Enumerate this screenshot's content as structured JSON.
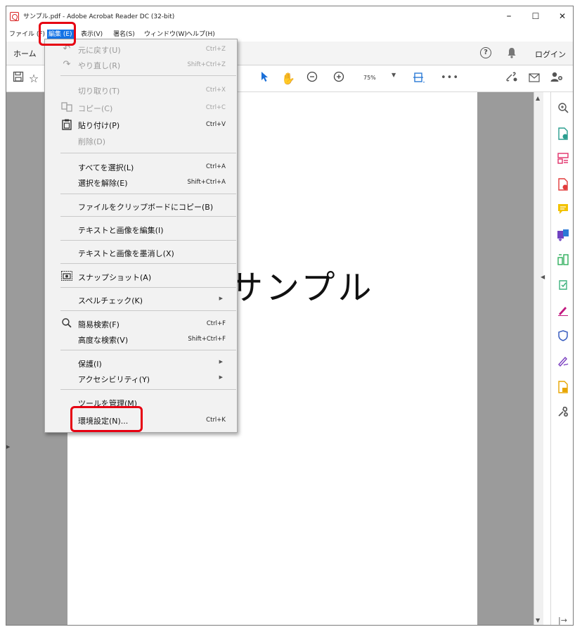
{
  "window": {
    "title": "サンプル.pdf - Adobe Acrobat Reader DC (32-bit)",
    "minimize": "–",
    "maximize": "☐",
    "close": "✕"
  },
  "menubar": {
    "items": [
      {
        "label": "ファイル (F)"
      },
      {
        "label": "編集 (E)"
      },
      {
        "label": "表示(V)"
      },
      {
        "label": "署名(S)"
      },
      {
        "label": "ウィンドウ(W)"
      },
      {
        "label": "ヘルプ(H)"
      }
    ]
  },
  "navbar": {
    "home": "ホーム",
    "help": "?",
    "login": "ログイン"
  },
  "toolbar": {
    "zoom": "75%"
  },
  "document": {
    "text": "サンプル"
  },
  "edit_menu": {
    "items": [
      {
        "label": "元に戻す(U)",
        "shortcut": "Ctrl+Z",
        "disabled": true
      },
      {
        "label": "やり直し(R)",
        "shortcut": "Shift+Ctrl+Z",
        "disabled": true
      },
      {
        "label": "切り取り(T)",
        "shortcut": "Ctrl+X",
        "disabled": true
      },
      {
        "label": "コピー(C)",
        "shortcut": "Ctrl+C",
        "disabled": true
      },
      {
        "label": "貼り付け(P)",
        "shortcut": "Ctrl+V",
        "disabled": false
      },
      {
        "label": "削除(D)",
        "shortcut": "",
        "disabled": true
      },
      {
        "label": "すべてを選択(L)",
        "shortcut": "Ctrl+A",
        "disabled": false
      },
      {
        "label": "選択を解除(E)",
        "shortcut": "Shift+Ctrl+A",
        "disabled": false
      },
      {
        "label": "ファイルをクリップボードにコピー(B)",
        "shortcut": "",
        "disabled": false
      },
      {
        "label": "テキストと画像を編集(I)",
        "shortcut": "",
        "disabled": false
      },
      {
        "label": "テキストと画像を墨消し(X)",
        "shortcut": "",
        "disabled": false
      },
      {
        "label": "スナップショット(A)",
        "shortcut": "",
        "disabled": false
      },
      {
        "label": "スペルチェック(K)",
        "shortcut": "",
        "disabled": false
      },
      {
        "label": "簡易検索(F)",
        "shortcut": "Ctrl+F",
        "disabled": false
      },
      {
        "label": "高度な検索(V)",
        "shortcut": "Shift+Ctrl+F",
        "disabled": false
      },
      {
        "label": "保護(I)",
        "shortcut": "",
        "disabled": false
      },
      {
        "label": "アクセシビリティ(Y)",
        "shortcut": "",
        "disabled": false
      },
      {
        "label": "ツールを管理(M)",
        "shortcut": "",
        "disabled": false
      },
      {
        "label": "環境設定(N)...",
        "shortcut": "Ctrl+K",
        "disabled": false
      }
    ]
  },
  "colors": {
    "accent": "#1473e6",
    "highlight": "#e60012",
    "rb_search": "#555555",
    "rb_export": "#2a9d8f",
    "rb_organize": "#e0306a",
    "rb_create": "#e23b3b",
    "rb_comment": "#f2c200",
    "rb_combine": "#6f42c1",
    "rb_edit": "#2eae5b",
    "rb_fill": "#3fb27f",
    "rb_sign": "#c2187f",
    "rb_protect": "#3b5fc0",
    "rb_cert": "#7a3fbf",
    "rb_send": "#e8a600",
    "rb_more": "#555555"
  }
}
